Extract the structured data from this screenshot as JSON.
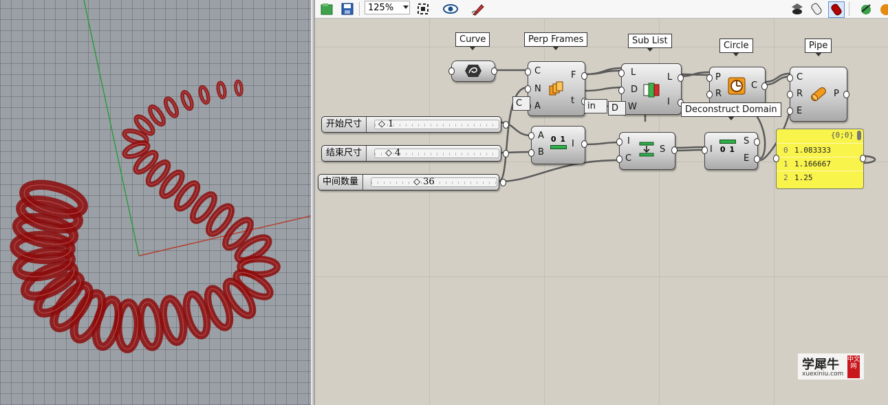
{
  "toolbar": {
    "zoom_value": "125%",
    "icons": [
      "open-icon",
      "save-icon",
      "zoom-extents-icon",
      "preview-icon",
      "sketch-icon",
      "shaded-preview-icon",
      "wireframe-icon",
      "preview-red-icon",
      "bake-icon",
      "sphere-icon"
    ]
  },
  "labels": {
    "curve": "Curve",
    "perp_frames": "Perp Frames",
    "sub_list": "Sub List",
    "circle": "Circle",
    "pipe": "Pipe",
    "deconstruct_domain": "Deconstruct Domain",
    "construct_domain_partial_a": "C",
    "construct_domain_partial_b": "in",
    "sub_list_partial": "D"
  },
  "components": {
    "perp_frames": {
      "inputs": [
        "C",
        "N",
        "A"
      ],
      "outputs": [
        "F",
        "t"
      ]
    },
    "sub_list": {
      "inputs": [
        "L",
        "D",
        "W"
      ],
      "outputs": [
        "L",
        "I"
      ]
    },
    "circle": {
      "inputs": [
        "P",
        "R"
      ],
      "outputs": [
        "C"
      ]
    },
    "pipe": {
      "inputs": [
        "C",
        "R",
        "E"
      ],
      "outputs": [
        "P"
      ]
    },
    "construct_domain": {
      "inputs": [
        "A",
        "B"
      ],
      "outputs": [
        "I"
      ],
      "icon_text": "0 1"
    },
    "remap": {
      "inputs": [
        "I",
        "C"
      ],
      "outputs": [
        "S"
      ]
    },
    "deconstruct_domain": {
      "inputs": [
        "I"
      ],
      "outputs": [
        "S",
        "E"
      ],
      "icon_text": "0 1"
    }
  },
  "sliders": [
    {
      "name": "开始尺寸",
      "value": "1"
    },
    {
      "name": "结束尺寸",
      "value": "4"
    },
    {
      "name": "中间数量",
      "value": "36"
    }
  ],
  "panel": {
    "path": "{0;0}",
    "rows": [
      {
        "index": "0",
        "value": "1.083333"
      },
      {
        "index": "1",
        "value": "1.166667"
      },
      {
        "index": "2",
        "value": "1.25"
      }
    ]
  },
  "watermark": {
    "brand": "学犀牛",
    "domain": "xuexiniu.com",
    "badge": "中文网"
  },
  "colors": {
    "pipe_red": "#8b0a0a",
    "panel_yellow": "#f9f44c",
    "axis_x": "#b4402f",
    "axis_y": "#2f9a3a"
  }
}
